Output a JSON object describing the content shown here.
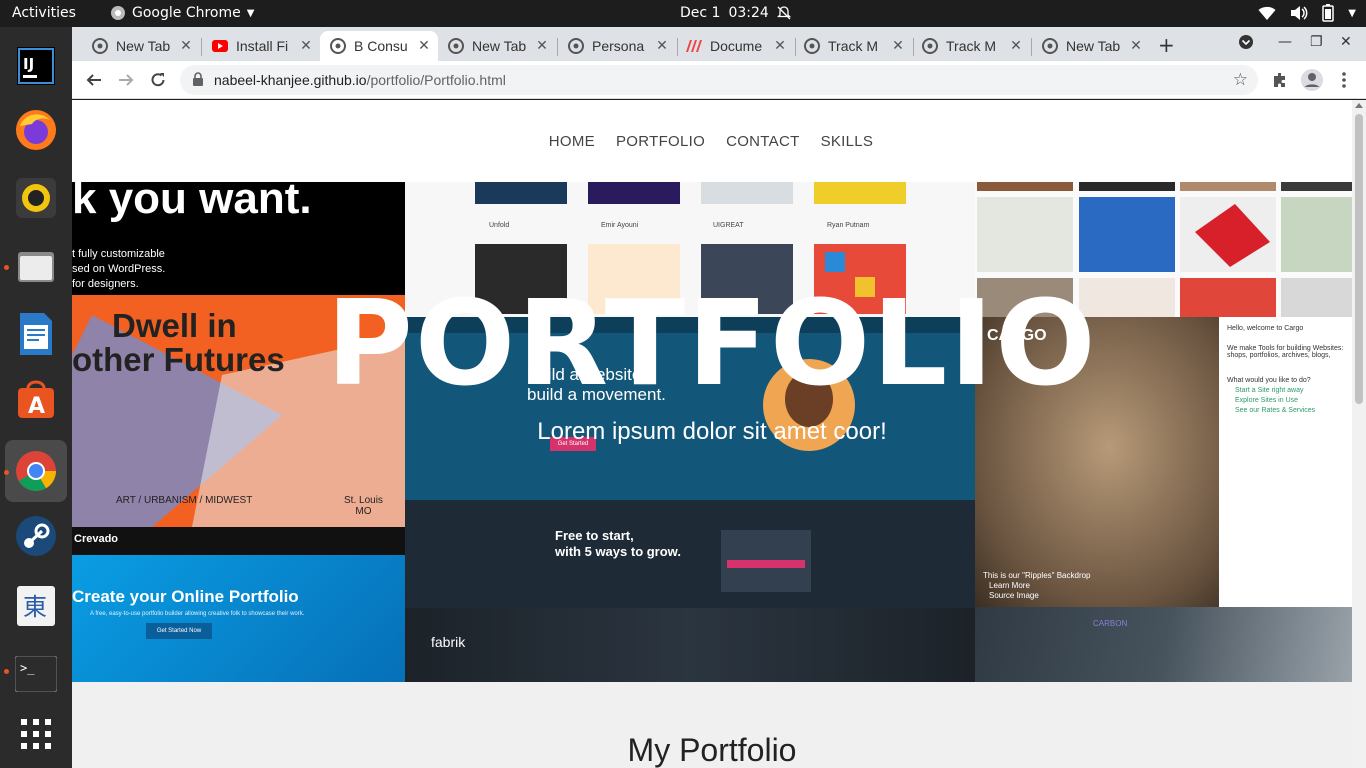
{
  "system": {
    "activities": "Activities",
    "app_name": "Google Chrome",
    "date": "Dec 1",
    "time": "03:24"
  },
  "tabs": [
    {
      "title": "New Tab",
      "favicon": "chrome-icon"
    },
    {
      "title": "Install Fi",
      "favicon": "youtube-icon"
    },
    {
      "title": "B Consu",
      "favicon": "chrome-icon",
      "active": true
    },
    {
      "title": "New Tab",
      "favicon": "chrome-icon"
    },
    {
      "title": "Persona",
      "favicon": "chrome-icon"
    },
    {
      "title": "Docume",
      "favicon": "docs-icon"
    },
    {
      "title": "Track M",
      "favicon": "chrome-icon"
    },
    {
      "title": "Track M",
      "favicon": "chrome-icon"
    },
    {
      "title": "New Tab",
      "favicon": "chrome-icon"
    }
  ],
  "address": {
    "host": "nabeel-khanjee.github.io",
    "path": "/portfolio/Portfolio.html"
  },
  "site": {
    "nav": [
      "HOME",
      "PORTFOLIO",
      "CONTACT",
      "SKILLS"
    ],
    "hero_title": "PORTFOLIO",
    "hero_subtitle": "Lorem ipsum dolor sit amet coor!",
    "section_title": "My Portfolio"
  },
  "collage_text": {
    "headline_1": "k you want.",
    "caption_1a": "t fully customizable",
    "caption_1b": "sed on WordPress.",
    "caption_1c": "for designers.",
    "dwell_1": "Dwell in",
    "dwell_2": "other Futures",
    "art_label": "ART / URBANISM / MIDWEST",
    "st_louis": "St. Louis\nMO",
    "crevado": "Crevado",
    "create_portfolio": "Create your Online Portfolio",
    "create_desc": "A free, easy-to-use portfolio builder allowing creative folk to showcase their work.",
    "get_started": "Get Started Now",
    "wp_line1": "Build a website,",
    "wp_line2": "build a movement.",
    "wp_btn": "Get Started",
    "free_1": "Free to start,",
    "free_2": "with 5 ways to grow.",
    "fabrik": "fabrik",
    "cargo": "CARGO",
    "cargo_hello": "Hello, welcome to Cargo",
    "cargo_tools": "We make Tools for building Websites: shops, portfolios, archives, blogs,",
    "cargo_q": "What would you like to do?",
    "cargo_opt1": "Start a Site right away",
    "cargo_opt2": "Explore Sites in Use",
    "cargo_opt3": "See our Rates & Services",
    "ripples": "This is our \"Ripples\" Backdrop",
    "learn_more": "Learn More",
    "source_image": "Source Image",
    "carbon": "CARBON",
    "unfold": "Unfold",
    "emir": "Emir Ayouni",
    "uigreat": "UIGREAT",
    "ryan": "Ryan Putnam"
  },
  "colors": {
    "accent_orange": "#f26122",
    "wp_blue": "#12577a",
    "crevado_blue": "#0a8fd6",
    "ubuntu_orange": "#e95420"
  }
}
